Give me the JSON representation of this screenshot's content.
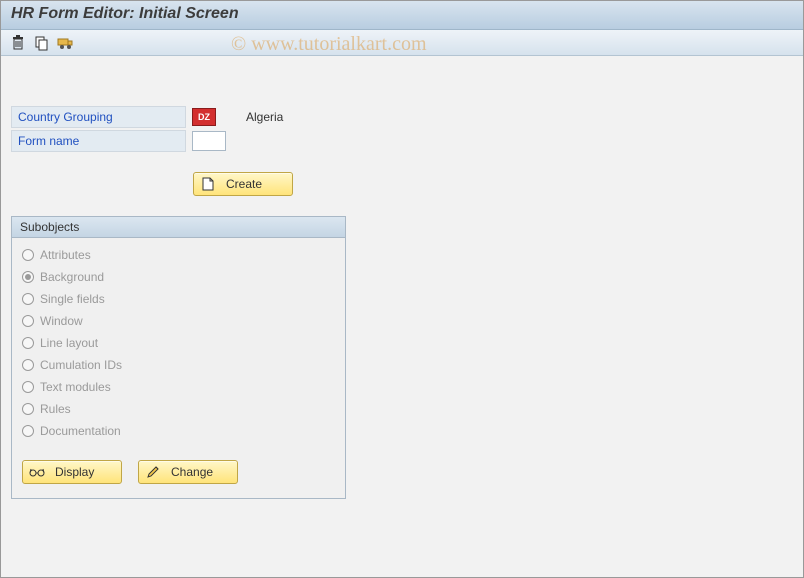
{
  "title": "HR Form Editor: Initial Screen",
  "watermark": "© www.tutorialkart.com",
  "fields": {
    "country_grouping_label": "Country Grouping",
    "country_grouping_value": "DZ",
    "country_grouping_desc": "Algeria",
    "form_name_label": "Form name",
    "form_name_value": ""
  },
  "buttons": {
    "create": "Create",
    "display": "Display",
    "change": "Change"
  },
  "subobjects": {
    "title": "Subobjects",
    "options": [
      {
        "label": "Attributes",
        "selected": false
      },
      {
        "label": "Background",
        "selected": true
      },
      {
        "label": "Single fields",
        "selected": false
      },
      {
        "label": "Window",
        "selected": false
      },
      {
        "label": "Line layout",
        "selected": false
      },
      {
        "label": "Cumulation IDs",
        "selected": false
      },
      {
        "label": "Text modules",
        "selected": false
      },
      {
        "label": "Rules",
        "selected": false
      },
      {
        "label": "Documentation",
        "selected": false
      }
    ]
  }
}
